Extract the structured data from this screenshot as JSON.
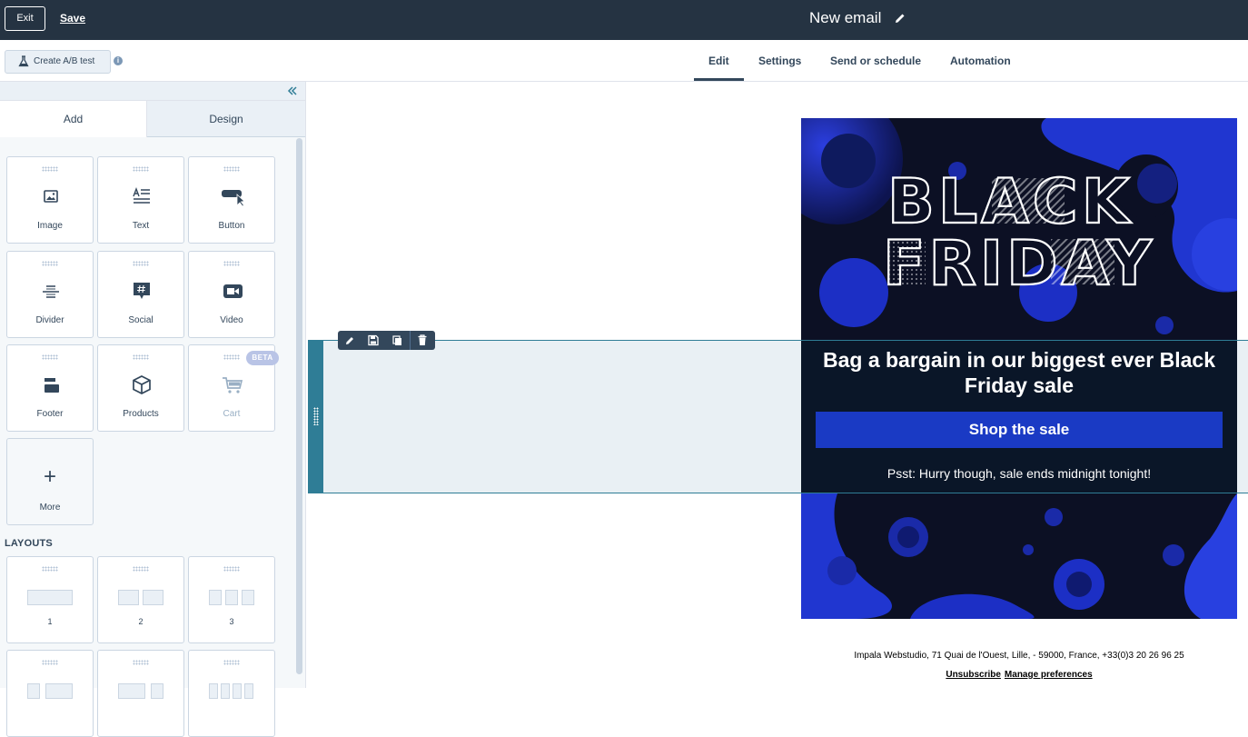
{
  "topbar": {
    "exit_label": "Exit",
    "save_label": "Save",
    "email_title": "New email"
  },
  "subbar": {
    "ab_test_label": "Create A/B test",
    "info_glyph": "i",
    "tabs": [
      {
        "label": "Edit",
        "active": true
      },
      {
        "label": "Settings"
      },
      {
        "label": "Send or schedule"
      },
      {
        "label": "Automation"
      }
    ]
  },
  "panel": {
    "tabs": [
      {
        "label": "Add",
        "active": true
      },
      {
        "label": "Design"
      }
    ],
    "modules": [
      {
        "label": "Image",
        "icon": "image-icon"
      },
      {
        "label": "Text",
        "icon": "text-icon"
      },
      {
        "label": "Button",
        "icon": "button-icon"
      },
      {
        "label": "Divider",
        "icon": "divider-icon"
      },
      {
        "label": "Social",
        "icon": "social-icon"
      },
      {
        "label": "Video",
        "icon": "video-icon"
      },
      {
        "label": "Footer",
        "icon": "footer-icon"
      },
      {
        "label": "Products",
        "icon": "products-icon"
      },
      {
        "label": "Cart",
        "icon": "cart-icon",
        "badge": "BETA",
        "disabled": true
      }
    ],
    "more_label": "More",
    "more_glyph": "+",
    "layouts_heading": "LAYOUTS",
    "layouts": [
      {
        "label": "1"
      },
      {
        "label": "2"
      },
      {
        "label": "3"
      }
    ]
  },
  "email": {
    "hero_lines": [
      "BLACK",
      "FRIDAY"
    ],
    "headline": "Bag a bargain in our biggest ever Black Friday sale",
    "cta_label": "Shop the sale",
    "note": "Psst: Hurry though, sale ends midnight tonight!",
    "footer_address": "Impala Webstudio, 71 Quai de l'Ouest, Lille, - 59000, France, +33(0)3 20 26 96 25",
    "unsubscribe_label": "Unsubscribe",
    "preferences_label": "Manage preferences"
  },
  "colors": {
    "topbar": "#253342",
    "accent_teal": "#2f7d96",
    "cta_blue": "#1a3ac4",
    "promo_bg": "#0a1628"
  }
}
